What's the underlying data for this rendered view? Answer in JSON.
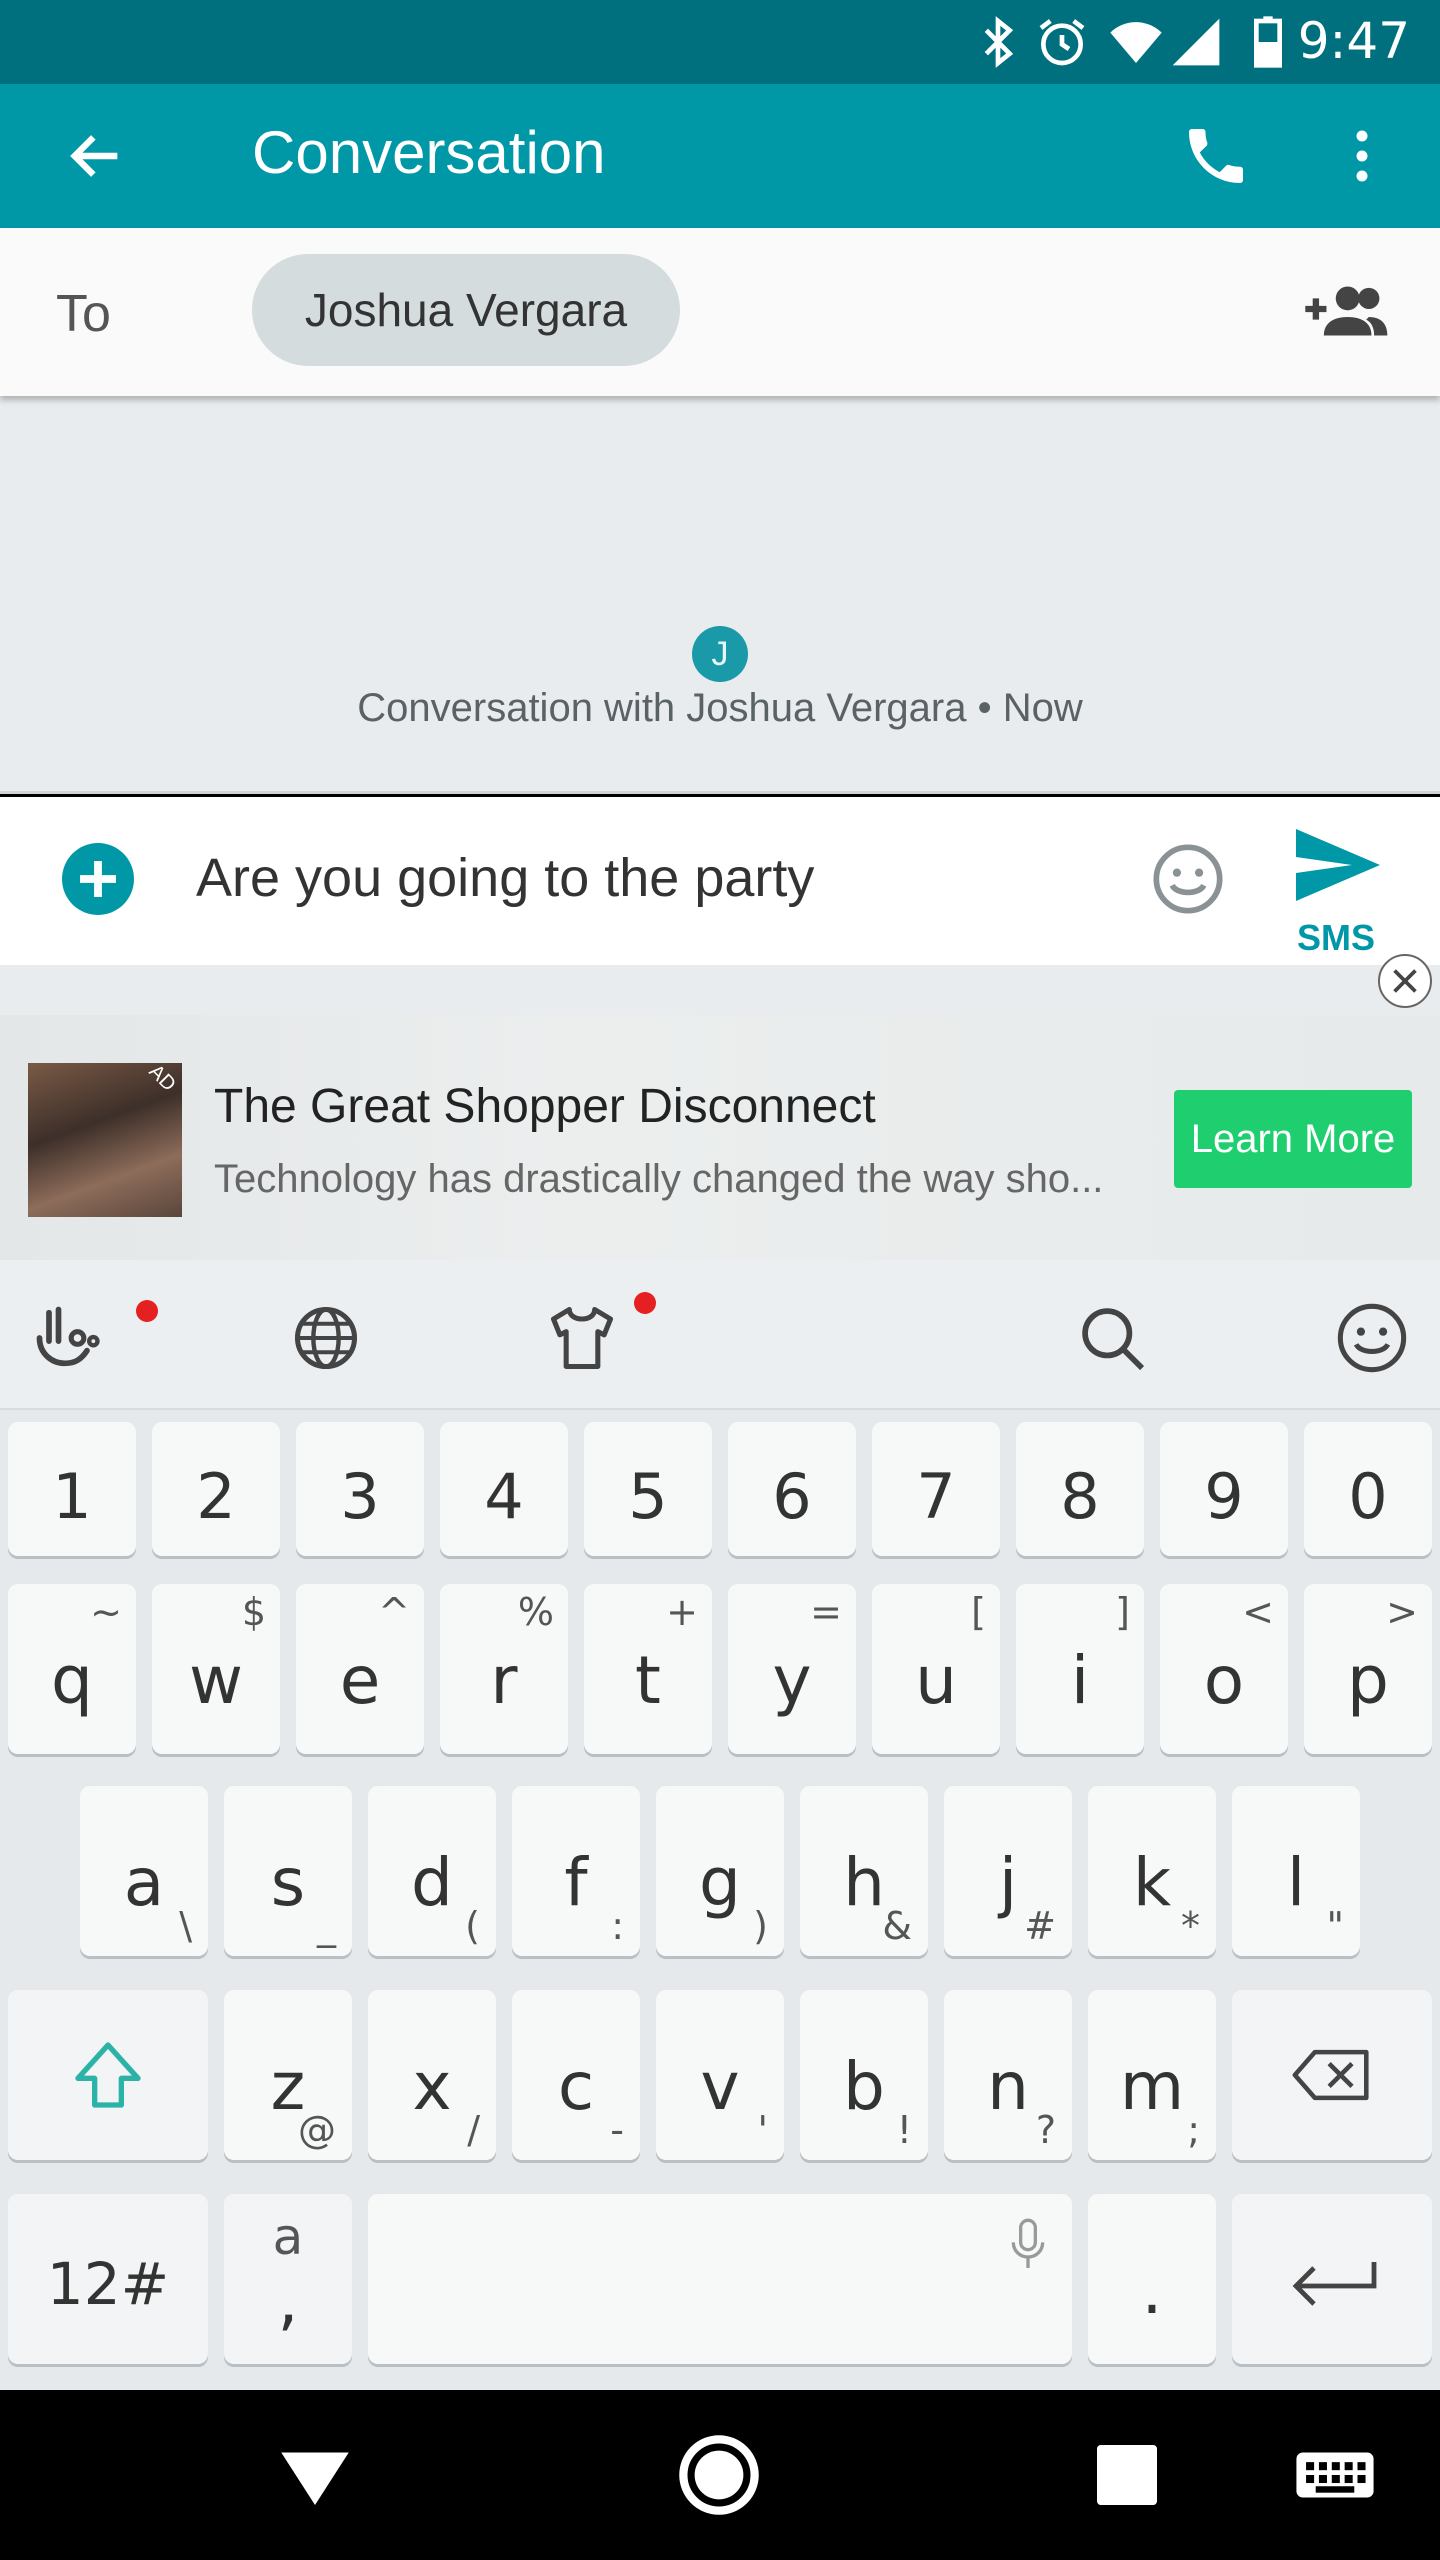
{
  "status_bar": {
    "time": "9:47",
    "icons": [
      "bluetooth-icon",
      "alarm-icon",
      "wifi-icon",
      "signal-icon",
      "battery-icon"
    ]
  },
  "app_bar": {
    "title": "Conversation",
    "icons": [
      "back-arrow-icon",
      "phone-icon",
      "more-vert-icon"
    ]
  },
  "recipient": {
    "to_label": "To",
    "name": "Joshua Vergara"
  },
  "conversation": {
    "avatar_initial": "J",
    "caption": "Conversation with Joshua Vergara • Now"
  },
  "composer": {
    "message": "Are you going to the party",
    "send_label": "SMS"
  },
  "ad": {
    "headline": "The Great Shopper Disconnect",
    "body": "Technology has drastically changed the way sho...",
    "cta": "Learn More",
    "badge": "AD"
  },
  "keyboard": {
    "toolbar_icons": [
      "touchpal-hand-icon",
      "globe-icon",
      "theme-shirt-icon",
      "search-icon",
      "emoji-icon"
    ],
    "number_row": [
      "1",
      "2",
      "3",
      "4",
      "5",
      "6",
      "7",
      "8",
      "9",
      "0"
    ],
    "row1": [
      {
        "k": "q",
        "h": "~"
      },
      {
        "k": "w",
        "h": "$"
      },
      {
        "k": "e",
        "h": "^"
      },
      {
        "k": "r",
        "h": "%"
      },
      {
        "k": "t",
        "h": "+"
      },
      {
        "k": "y",
        "h": "="
      },
      {
        "k": "u",
        "h": "["
      },
      {
        "k": "i",
        "h": "]"
      },
      {
        "k": "o",
        "h": "<"
      },
      {
        "k": "p",
        "h": ">"
      }
    ],
    "row2": [
      {
        "k": "a",
        "h": "\\"
      },
      {
        "k": "s",
        "h": "_"
      },
      {
        "k": "d",
        "h": "("
      },
      {
        "k": "f",
        "h": ":"
      },
      {
        "k": "g",
        "h": ")"
      },
      {
        "k": "h",
        "h": "&"
      },
      {
        "k": "j",
        "h": "#"
      },
      {
        "k": "k",
        "h": "*"
      },
      {
        "k": "l",
        "h": "\""
      }
    ],
    "row3": [
      {
        "k": "z",
        "h": "@"
      },
      {
        "k": "x",
        "h": "/"
      },
      {
        "k": "c",
        "h": "-"
      },
      {
        "k": "v",
        "h": "'"
      },
      {
        "k": "b",
        "h": "!"
      },
      {
        "k": "n",
        "h": "?"
      },
      {
        "k": "m",
        "h": ";"
      }
    ],
    "symbols_label": "12#",
    "lang_top": "a",
    "lang_bottom": ",",
    "period": "."
  },
  "nav_bar": {
    "icons": [
      "back-triangle-icon",
      "home-circle-icon",
      "recents-square-icon",
      "keyboard-switch-icon"
    ]
  },
  "colors": {
    "primary": "#0097a7",
    "primary_dark": "#00707f",
    "cta_green": "#1fcf6f"
  }
}
